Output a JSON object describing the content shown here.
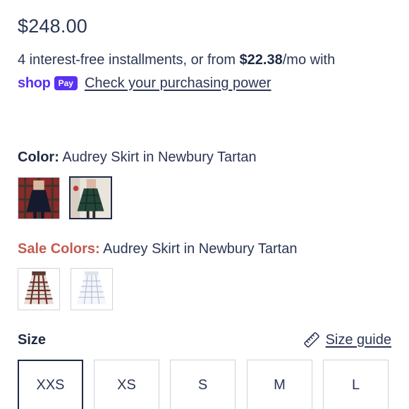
{
  "price": "$248.00",
  "installments": {
    "prefix": "4 interest-free installments, or from ",
    "amount": "$22.38",
    "suffix": "/mo with"
  },
  "shoppay": {
    "shop_word": "shop",
    "pay_badge": "Pay",
    "link_label": "Check your purchasing power"
  },
  "color": {
    "key": "Color:",
    "value": "Audrey Skirt in Newbury Tartan",
    "swatches": [
      {
        "name": "navy skirt with red tartan backdrop",
        "selected": false
      },
      {
        "name": "green tartan skirt",
        "selected": true
      }
    ]
  },
  "sale_colors": {
    "key": "Sale Colors:",
    "value": "Audrey Skirt in Newbury Tartan",
    "swatches": [
      {
        "name": "brown plaid skirt",
        "selected": false
      },
      {
        "name": "white gingham skirt",
        "selected": false
      }
    ]
  },
  "size": {
    "label": "Size",
    "guide_label": "Size guide",
    "guide_icon": "ruler-icon",
    "options": [
      "XXS",
      "XS",
      "S",
      "M",
      "L"
    ],
    "selected": "XXS"
  },
  "colors": {
    "text": "#2b3654",
    "heading": "#1f2a44",
    "sale": "#c45a4f",
    "shoppay": "#5a31f4",
    "border": "#cfd3dc"
  }
}
